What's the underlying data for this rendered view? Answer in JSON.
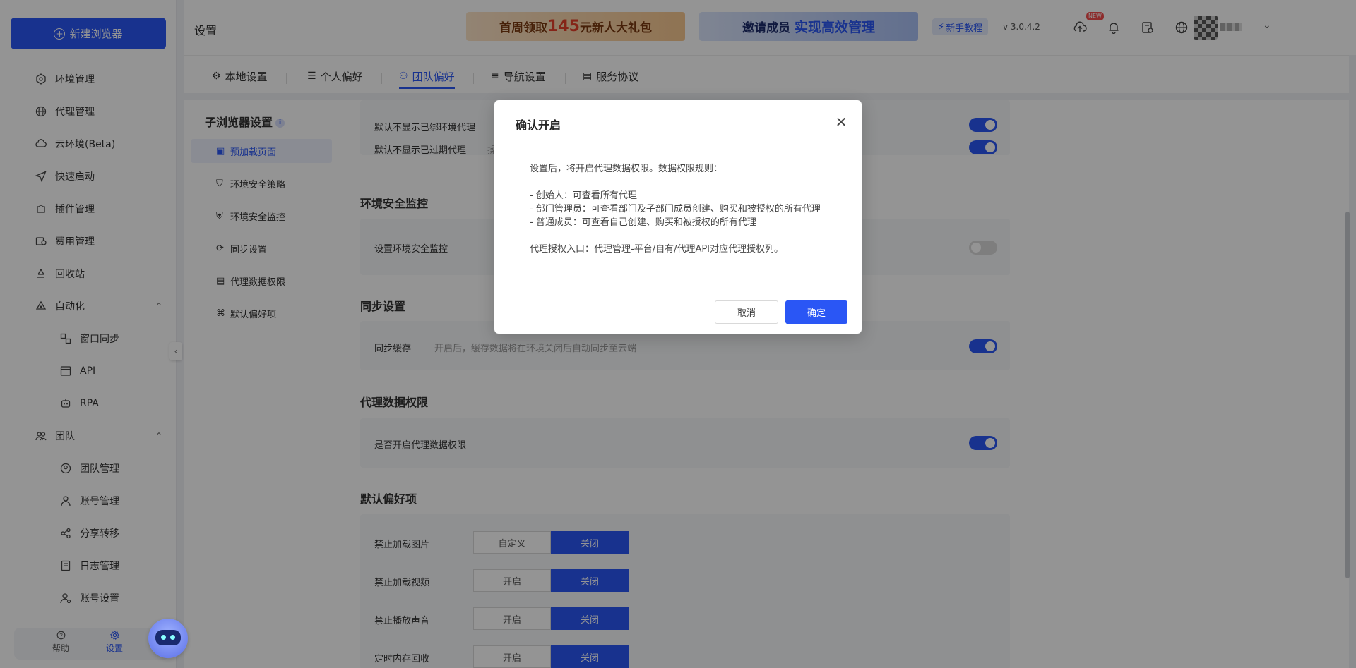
{
  "sidebar": {
    "new_browser_label": "新建浏览器",
    "items": [
      {
        "label": "环境管理",
        "icon": "environment-icon"
      },
      {
        "label": "代理管理",
        "icon": "globe-icon"
      },
      {
        "label": "云环境(Beta)",
        "icon": "cloud-icon"
      },
      {
        "label": "快速启动",
        "icon": "send-icon"
      },
      {
        "label": "插件管理",
        "icon": "puzzle-icon"
      },
      {
        "label": "费用管理",
        "icon": "billing-icon"
      },
      {
        "label": "回收站",
        "icon": "recycle-icon"
      },
      {
        "label": "自动化",
        "icon": "automation-icon"
      },
      {
        "label": "窗口同步",
        "icon": "window-sync-icon"
      },
      {
        "label": "API",
        "icon": "api-icon"
      },
      {
        "label": "RPA",
        "icon": "robot-icon"
      },
      {
        "label": "团队",
        "icon": "team-icon"
      },
      {
        "label": "团队管理",
        "icon": "team-manage-icon"
      },
      {
        "label": "账号管理",
        "icon": "user-icon"
      },
      {
        "label": "分享转移",
        "icon": "share-icon"
      },
      {
        "label": "日志管理",
        "icon": "log-icon"
      },
      {
        "label": "账号设置",
        "icon": "user-settings-icon"
      }
    ],
    "help_label": "帮助",
    "settings_label": "设置"
  },
  "header": {
    "title": "设置",
    "promo1_prefix": "首周领取",
    "promo1_amount": "145",
    "promo1_suffix": "元新人大礼包",
    "promo2_prefix": "邀请成员",
    "promo2_highlight": "实现高效管理",
    "tutorial_label": "新手教程",
    "version": "v 3.0.4.2",
    "new_badge": "NEW"
  },
  "tabs": [
    {
      "label": "本地设置",
      "icon": "gear-icon"
    },
    {
      "label": "个人偏好",
      "icon": "sliders-icon"
    },
    {
      "label": "团队偏好",
      "icon": "team-icon"
    },
    {
      "label": "导航设置",
      "icon": "list-icon"
    },
    {
      "label": "服务协议",
      "icon": "document-icon"
    }
  ],
  "subnav": {
    "title": "子浏览器设置",
    "info_glyph": "i",
    "items": [
      {
        "label": "预加载页面"
      },
      {
        "label": "环境安全策略"
      },
      {
        "label": "环境安全监控"
      },
      {
        "label": "同步设置"
      },
      {
        "label": "代理数据权限"
      },
      {
        "label": "默认偏好项"
      }
    ]
  },
  "settings": {
    "row_hide_unbound": "默认不显示已绑环境代理",
    "row_hide_expired": "默认不显示已过期代理",
    "row_hide_expired_desc": "操",
    "section_security": "环境安全监控",
    "row_security": "设置环境安全监控",
    "section_sync": "同步设置",
    "row_sync": "同步缓存",
    "row_sync_desc": "开启后，缓存数据将在环境关闭后自动同步至云端",
    "section_proxy": "代理数据权限",
    "row_proxy": "是否开启代理数据权限",
    "section_default": "默认偏好项",
    "pref_rows": [
      {
        "label": "禁止加载图片",
        "left": "自定义",
        "right": "关闭"
      },
      {
        "label": "禁止加载视频",
        "left": "开启",
        "right": "关闭"
      },
      {
        "label": "禁止播放声音",
        "left": "开启",
        "right": "关闭"
      },
      {
        "label": "定时内存回收",
        "left": "开启",
        "right": "关闭"
      }
    ]
  },
  "modal": {
    "title": "确认开启",
    "line1": "设置后，将开启代理数据权限。数据权限规则：",
    "line2": "- 创始人：可查看所有代理",
    "line3": "- 部门管理员：可查看部门及子部门成员创建、购买和被授权的所有代理",
    "line4": "- 普通成员：可查看自己创建、购买和被授权的所有代理",
    "line5": "代理授权入口：代理管理-平台/自有/代理API对应代理授权列。",
    "cancel_label": "取消",
    "ok_label": "确定"
  },
  "colors": {
    "accent": "#2a56f5",
    "toggle_off": "#d9d9d9"
  }
}
